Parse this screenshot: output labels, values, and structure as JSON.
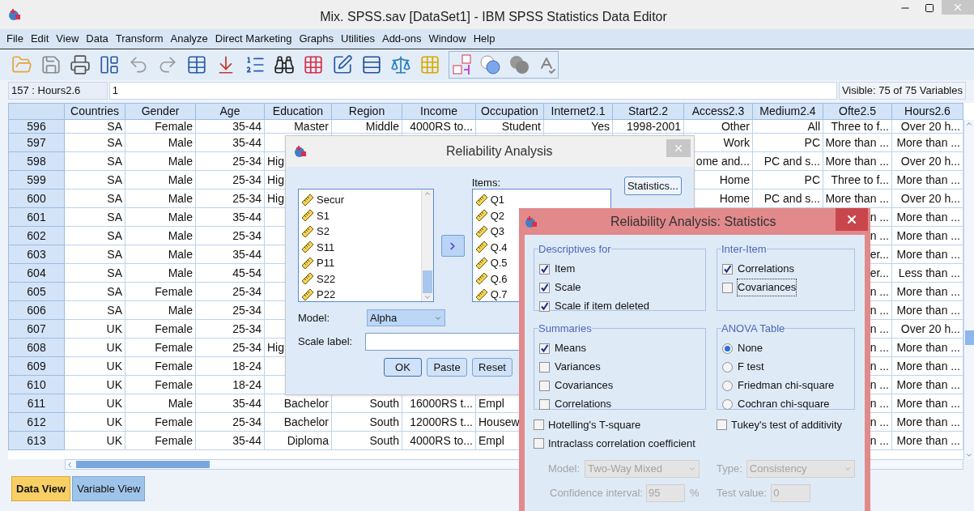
{
  "window": {
    "title": "Mix. SPSS.sav [DataSet1] - IBM SPSS Statistics Data Editor"
  },
  "menu": [
    "File",
    "Edit",
    "View",
    "Data",
    "Transform",
    "Analyze",
    "Direct Marketing",
    "Graphs",
    "Utilities",
    "Add-ons",
    "Window",
    "Help"
  ],
  "cell_editor": {
    "cell": "157 : Hours2.6",
    "value": "1",
    "visible": "Visible: 75 of 75 Variables"
  },
  "grid": {
    "columns": [
      "Countries",
      "Gender",
      "Age",
      "Education",
      "Region",
      "Income",
      "Occupation",
      "Internet2.1",
      "Start2.2",
      "Access2.3",
      "Medium2.4",
      "Ofte2.5",
      "Hours2.6"
    ],
    "rows": [
      {
        "number": "596",
        "countries": "SA",
        "gender": "Female",
        "age": "35-44",
        "education": "Master",
        "region": "Middle",
        "income": "4000RS to...",
        "occupation": "Student",
        "internet": "Yes",
        "start": "1998-2001",
        "access": "Other",
        "medium": "All",
        "ofte": "Three to f...",
        "hours": "Over 20 h..."
      },
      {
        "number": "597",
        "countries": "SA",
        "gender": "Male",
        "age": "35-44",
        "access": "Work",
        "medium": "PC",
        "ofte": "More than ...",
        "hours": "More than ..."
      },
      {
        "number": "598",
        "countries": "SA",
        "gender": "Male",
        "age": "25-34",
        "education": {
          "text": "Hig",
          "clipped_right": true
        },
        "access": "ome and...",
        "medium": "PC and s...",
        "ofte": "More than ...",
        "hours": "Over 20 h..."
      },
      {
        "number": "599",
        "countries": "SA",
        "gender": "Male",
        "age": "25-34",
        "education": {
          "text": "Hig",
          "clipped_right": true
        },
        "access": "Home",
        "medium": "PC",
        "ofte": "Three to f...",
        "hours": "More than ..."
      },
      {
        "number": "600",
        "countries": "SA",
        "gender": "Male",
        "age": "25-34",
        "education": {
          "text": "Hig",
          "clipped_right": true
        },
        "access": "Home",
        "medium": "PC and s...",
        "ofte": "More than ...",
        "hours": "Over 20 h..."
      },
      {
        "number": "601",
        "countries": "SA",
        "gender": "Male",
        "age": "35-44",
        "ofte": "n ...",
        "hours": "More than ..."
      },
      {
        "number": "602",
        "countries": "SA",
        "gender": "Male",
        "age": "25-34",
        "ofte": "n ...",
        "hours": "More than ..."
      },
      {
        "number": "603",
        "countries": "SA",
        "gender": "Male",
        "age": "35-44",
        "ofte": "er...",
        "hours": "More than ..."
      },
      {
        "number": "604",
        "countries": "SA",
        "gender": "Male",
        "age": "45-54",
        "ofte": "er...",
        "hours": "Less than ..."
      },
      {
        "number": "605",
        "countries": "SA",
        "gender": "Female",
        "age": "25-34",
        "ofte": "n ...",
        "hours": "More than ..."
      },
      {
        "number": "606",
        "countries": "SA",
        "gender": "Male",
        "age": "25-34",
        "ofte": "n ...",
        "hours": "More than ..."
      },
      {
        "number": "607",
        "countries": "UK",
        "gender": "Female",
        "age": "25-34",
        "ofte": "n ...",
        "hours": "Over 20 h..."
      },
      {
        "number": "608",
        "countries": "UK",
        "gender": "Female",
        "age": "25-34",
        "education": {
          "text": "Hig",
          "clipped_right": true
        },
        "ofte": "n ...",
        "hours": "More than ..."
      },
      {
        "number": "609",
        "countries": "UK",
        "gender": "Female",
        "age": "18-24",
        "ofte": "n ...",
        "hours": "More than ..."
      },
      {
        "number": "610",
        "countries": "UK",
        "gender": "Female",
        "age": "18-24",
        "ofte": "n ...",
        "hours": "More than ..."
      },
      {
        "number": "611",
        "countries": "UK",
        "gender": "Male",
        "age": "35-44",
        "education": "Bachelor",
        "region": "South",
        "income": "16000RS t...",
        "occupation": {
          "text": "Empl",
          "clipped_right": true
        },
        "ofte": "n ...",
        "hours": "More than ..."
      },
      {
        "number": "612",
        "countries": "UK",
        "gender": "Female",
        "age": "25-34",
        "education": "Bachelor",
        "region": "South",
        "income": "12000RS t...",
        "occupation": {
          "text": "Housew",
          "clipped_right": true
        },
        "ofte": "n ...",
        "hours": "More than ..."
      },
      {
        "number": "613",
        "countries": "UK",
        "gender": "Female",
        "age": "35-44",
        "education": "Diploma",
        "region": "South",
        "income": "4000RS to...",
        "occupation": {
          "text": "Empl",
          "clipped_right": true
        },
        "ofte": "n ...",
        "hours": "More than ..."
      }
    ]
  },
  "view_tabs": [
    {
      "label": "Data View",
      "selected": true
    },
    {
      "label": "Variable View",
      "selected": false
    }
  ],
  "reliability_dialog": {
    "title": "Reliability Analysis",
    "variables": [
      "Secur",
      "S1",
      "S2",
      "S11",
      "P11",
      "S22",
      "P22"
    ],
    "items_label": "Items:",
    "items": [
      "Q1",
      "Q2",
      "Q3",
      "Q.4",
      "Q.5",
      "Q.6",
      "Q.7"
    ],
    "statistics_button": "Statistics...",
    "model_label": "Model:",
    "model": "Alpha",
    "scale_label": "Scale label:",
    "buttons": [
      "OK",
      "Paste",
      "Reset"
    ]
  },
  "statistics_dialog": {
    "title": "Reliability Analysis: Statistics",
    "groups": [
      {
        "title": "Descriptives for",
        "options": [
          {
            "kind": "checkbox",
            "label": "Item",
            "checked": true
          },
          {
            "kind": "checkbox",
            "label": "Scale",
            "checked": true
          },
          {
            "kind": "checkbox",
            "label": "Scale if item deleted",
            "checked": true
          }
        ]
      },
      {
        "title": "Inter-Item",
        "options": [
          {
            "kind": "checkbox",
            "label": "Correlations",
            "checked": true,
            "focused": false
          },
          {
            "kind": "checkbox",
            "label": "Covariances",
            "checked": false,
            "focused": true
          }
        ]
      },
      {
        "title": "Summaries",
        "options": [
          {
            "kind": "checkbox",
            "label": "Means",
            "checked": true
          },
          {
            "kind": "checkbox",
            "label": "Variances",
            "checked": false
          },
          {
            "kind": "checkbox",
            "label": "Covariances",
            "checked": false
          },
          {
            "kind": "checkbox",
            "label": "Correlations",
            "checked": false
          }
        ]
      },
      {
        "title": "ANOVA Table",
        "options": [
          {
            "kind": "radio",
            "label": "None",
            "selected": true
          },
          {
            "kind": "radio",
            "label": "F test",
            "selected": false
          },
          {
            "kind": "radio",
            "label": "Friedman chi-square",
            "selected": false
          },
          {
            "kind": "radio",
            "label": "Cochran chi-square",
            "selected": false
          }
        ]
      }
    ],
    "left_options": [
      {
        "label": "Hotelling's T-square",
        "checked": false
      },
      {
        "label": "Intraclass correlation coefficient",
        "checked": false
      }
    ],
    "right_options": [
      {
        "label": "Tukey's test of additivity",
        "checked": false
      }
    ],
    "icc": {
      "disabled": true,
      "model_label": "Model:",
      "model": "Two-Way Mixed",
      "type_label": "Type:",
      "type": "Consistency",
      "ci_label": "Confidence interval:",
      "ci": "95",
      "percent": "%",
      "test_label": "Test value:",
      "test": "0"
    }
  }
}
